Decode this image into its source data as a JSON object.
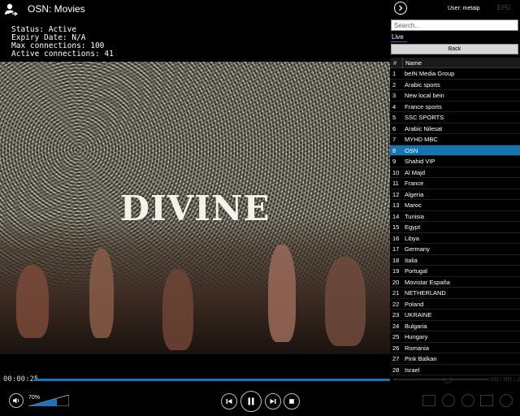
{
  "header": {
    "title": "OSN: Movies",
    "user_icon": "user-icon"
  },
  "status": {
    "line1": "Status: Active",
    "line2": "Expiry Date: N/A",
    "line3": "Max connections: 100",
    "line4": "Active connections: 41"
  },
  "video": {
    "overlay_text": "DIVINE"
  },
  "player": {
    "time_elapsed": "00:00:25",
    "time_remaining": "00:00:25",
    "seek_progress": 1.0,
    "volume_label": "70%",
    "volume_level": 0.7,
    "icons": [
      "volume-icon",
      "previous-icon",
      "pause-icon",
      "next-icon",
      "stop-icon"
    ]
  },
  "side": {
    "user_label": "User: metaip",
    "epg_label": "EPG",
    "search_placeholder": "Search...",
    "category": "Live",
    "back_label": "Back",
    "col_hash": "#",
    "col_name": "Name",
    "accent": "#1575b0",
    "channels": [
      {
        "num": "1",
        "name": "beIN Media Group"
      },
      {
        "num": "2",
        "name": "Arabic sports"
      },
      {
        "num": "3",
        "name": "New local bein"
      },
      {
        "num": "4",
        "name": "France sports"
      },
      {
        "num": "5",
        "name": "SSC SPORTS"
      },
      {
        "num": "6",
        "name": "Arabic Nilesat"
      },
      {
        "num": "7",
        "name": "MYHD MBC"
      },
      {
        "num": "8",
        "name": "OSN",
        "selected": true
      },
      {
        "num": "9",
        "name": "Shahid VIP"
      },
      {
        "num": "10",
        "name": "Al Majd"
      },
      {
        "num": "11",
        "name": "France"
      },
      {
        "num": "12",
        "name": "Algeria"
      },
      {
        "num": "13",
        "name": "Maroc"
      },
      {
        "num": "14",
        "name": "Tunisia"
      },
      {
        "num": "15",
        "name": "Egypt"
      },
      {
        "num": "16",
        "name": "Libya"
      },
      {
        "num": "17",
        "name": "Germany"
      },
      {
        "num": "18",
        "name": "Italia"
      },
      {
        "num": "19",
        "name": "Portugal"
      },
      {
        "num": "20",
        "name": "Movistar España"
      },
      {
        "num": "21",
        "name": "NETHERLAND"
      },
      {
        "num": "22",
        "name": "Poland"
      },
      {
        "num": "23",
        "name": "UKRAINE"
      },
      {
        "num": "24",
        "name": "Bulgaria"
      },
      {
        "num": "25",
        "name": "Hungary"
      },
      {
        "num": "26",
        "name": "Romania"
      },
      {
        "num": "27",
        "name": "Pink Balkan"
      },
      {
        "num": "28",
        "name": "Israel"
      }
    ]
  }
}
